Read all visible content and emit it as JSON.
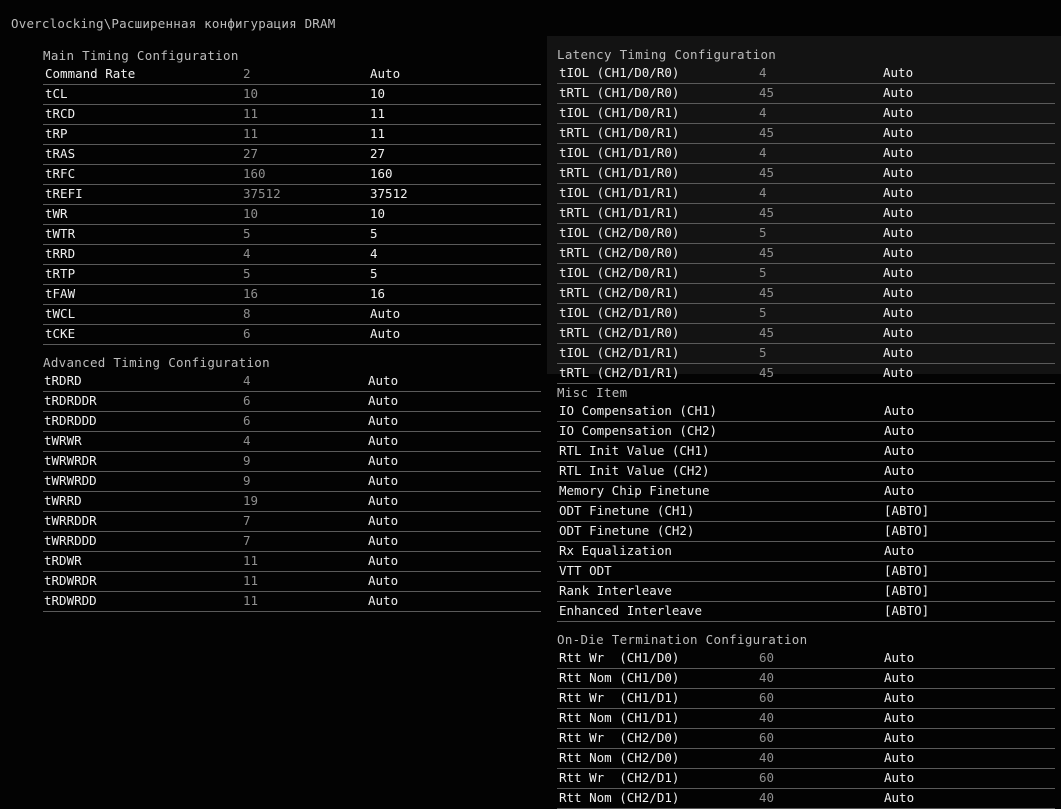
{
  "breadcrumb": "Overclocking\\Расширенная конфигурация DRAM",
  "main_timing": {
    "title": "Main Timing Configuration",
    "rows": [
      {
        "name": "Command Rate",
        "current": "2",
        "value": "Auto"
      },
      {
        "name": "tCL",
        "current": "10",
        "value": "10"
      },
      {
        "name": "tRCD",
        "current": "11",
        "value": "11"
      },
      {
        "name": "tRP",
        "current": "11",
        "value": "11"
      },
      {
        "name": "tRAS",
        "current": "27",
        "value": "27"
      },
      {
        "name": "tRFC",
        "current": "160",
        "value": "160"
      },
      {
        "name": "tREFI",
        "current": "37512",
        "value": "37512"
      },
      {
        "name": "tWR",
        "current": "10",
        "value": "10"
      },
      {
        "name": "tWTR",
        "current": "5",
        "value": "5"
      },
      {
        "name": "tRRD",
        "current": "4",
        "value": "4"
      },
      {
        "name": "tRTP",
        "current": "5",
        "value": "5"
      },
      {
        "name": "tFAW",
        "current": "16",
        "value": "16"
      },
      {
        "name": "tWCL",
        "current": "8",
        "value": "Auto"
      },
      {
        "name": "tCKE",
        "current": "6",
        "value": "Auto"
      }
    ]
  },
  "advanced_timing": {
    "title": "Advanced Timing Configuration",
    "rows": [
      {
        "name": "tRDRD",
        "current": "4",
        "value": "Auto"
      },
      {
        "name": "tRDRDDR",
        "current": "6",
        "value": "Auto"
      },
      {
        "name": "tRDRDDD",
        "current": "6",
        "value": "Auto"
      },
      {
        "name": "tWRWR",
        "current": "4",
        "value": "Auto"
      },
      {
        "name": "tWRWRDR",
        "current": "9",
        "value": "Auto"
      },
      {
        "name": "tWRWRDD",
        "current": "9",
        "value": "Auto"
      },
      {
        "name": "tWRRD",
        "current": "19",
        "value": "Auto"
      },
      {
        "name": "tWRRDDR",
        "current": "7",
        "value": "Auto"
      },
      {
        "name": "tWRRDDD",
        "current": "7",
        "value": "Auto"
      },
      {
        "name": "tRDWR",
        "current": "11",
        "value": "Auto"
      },
      {
        "name": "tRDWRDR",
        "current": "11",
        "value": "Auto"
      },
      {
        "name": "tRDWRDD",
        "current": "11",
        "value": "Auto"
      }
    ]
  },
  "latency_timing": {
    "title": "Latency Timing Configuration",
    "rows": [
      {
        "name": "tIOL (CH1/D0/R0)",
        "current": "4",
        "value": "Auto"
      },
      {
        "name": "tRTL (CH1/D0/R0)",
        "current": "45",
        "value": "Auto"
      },
      {
        "name": "tIOL (CH1/D0/R1)",
        "current": "4",
        "value": "Auto"
      },
      {
        "name": "tRTL (CH1/D0/R1)",
        "current": "45",
        "value": "Auto"
      },
      {
        "name": "tIOL (CH1/D1/R0)",
        "current": "4",
        "value": "Auto"
      },
      {
        "name": "tRTL (CH1/D1/R0)",
        "current": "45",
        "value": "Auto"
      },
      {
        "name": "tIOL (CH1/D1/R1)",
        "current": "4",
        "value": "Auto"
      },
      {
        "name": "tRTL (CH1/D1/R1)",
        "current": "45",
        "value": "Auto"
      },
      {
        "name": "tIOL (CH2/D0/R0)",
        "current": "5",
        "value": "Auto"
      },
      {
        "name": "tRTL (CH2/D0/R0)",
        "current": "45",
        "value": "Auto"
      },
      {
        "name": "tIOL (CH2/D0/R1)",
        "current": "5",
        "value": "Auto"
      },
      {
        "name": "tRTL (CH2/D0/R1)",
        "current": "45",
        "value": "Auto"
      },
      {
        "name": "tIOL (CH2/D1/R0)",
        "current": "5",
        "value": "Auto"
      },
      {
        "name": "tRTL (CH2/D1/R0)",
        "current": "45",
        "value": "Auto"
      },
      {
        "name": "tIOL (CH2/D1/R1)",
        "current": "5",
        "value": "Auto"
      },
      {
        "name": "tRTL (CH2/D1/R1)",
        "current": "45",
        "value": "Auto"
      }
    ]
  },
  "misc": {
    "title": "Misc Item",
    "rows": [
      {
        "name": "IO Compensation (CH1)",
        "current": "",
        "value": "Auto"
      },
      {
        "name": "IO Compensation (CH2)",
        "current": "",
        "value": "Auto"
      },
      {
        "name": "RTL Init Value (CH1)",
        "current": "",
        "value": "Auto"
      },
      {
        "name": "RTL Init Value (CH2)",
        "current": "",
        "value": "Auto"
      },
      {
        "name": "Memory Chip Finetune",
        "current": "",
        "value": "Auto"
      },
      {
        "name": "ODT Finetune (CH1)",
        "current": "",
        "value": "[ABTO]"
      },
      {
        "name": "ODT Finetune (CH2)",
        "current": "",
        "value": "[ABTO]"
      },
      {
        "name": "Rx Equalization",
        "current": "",
        "value": "Auto"
      },
      {
        "name": "VTT ODT",
        "current": "",
        "value": "[ABTO]"
      },
      {
        "name": "Rank Interleave",
        "current": "",
        "value": "[ABTO]"
      },
      {
        "name": "Enhanced Interleave",
        "current": "",
        "value": "[ABTO]"
      }
    ]
  },
  "odt": {
    "title": "On-Die Termination Configuration",
    "rows": [
      {
        "name": "Rtt Wr  (CH1/D0)",
        "current": "60",
        "value": "Auto"
      },
      {
        "name": "Rtt Nom (CH1/D0)",
        "current": "40",
        "value": "Auto"
      },
      {
        "name": "Rtt Wr  (CH1/D1)",
        "current": "60",
        "value": "Auto"
      },
      {
        "name": "Rtt Nom (CH1/D1)",
        "current": "40",
        "value": "Auto"
      },
      {
        "name": "Rtt Wr  (CH2/D0)",
        "current": "60",
        "value": "Auto"
      },
      {
        "name": "Rtt Nom (CH2/D0)",
        "current": "40",
        "value": "Auto"
      },
      {
        "name": "Rtt Wr  (CH2/D1)",
        "current": "60",
        "value": "Auto"
      },
      {
        "name": "Rtt Nom (CH2/D1)",
        "current": "40",
        "value": "Auto"
      }
    ]
  }
}
